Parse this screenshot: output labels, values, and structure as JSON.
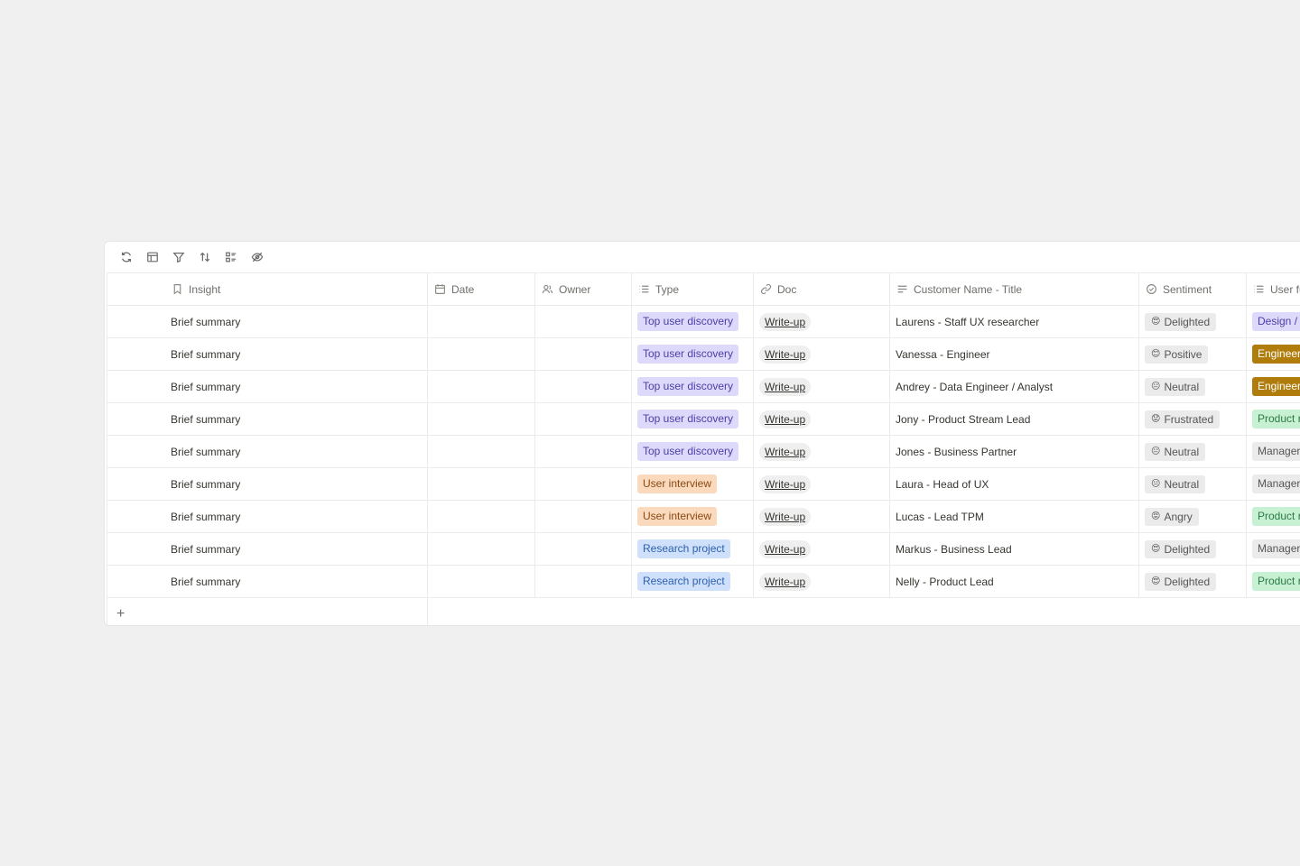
{
  "columns": {
    "insight": "Insight",
    "date": "Date",
    "owner": "Owner",
    "type": "Type",
    "doc": "Doc",
    "customer": "Customer Name - Title",
    "sentiment": "Sentiment",
    "user": "User fu"
  },
  "toolbar_icons": [
    "refresh-icon",
    "layout-icon",
    "filter-icon",
    "sort-icon",
    "group-icon",
    "hide-fields-icon"
  ],
  "type_colors": {
    "Top user discovery": {
      "bg": "#ddd9fb",
      "fg": "#4b3fa8"
    },
    "User interview": {
      "bg": "#fbd9bd",
      "fg": "#8a4a14"
    },
    "Research project": {
      "bg": "#cfe0fb",
      "fg": "#2d5fb0"
    }
  },
  "user_colors": {
    "Design /": {
      "bg": "#ddd9fb",
      "fg": "#4b3fa8"
    },
    "Engineer": {
      "bg": "#b07d0c",
      "fg": "#ffffff"
    },
    "Product r": {
      "bg": "#c8f0d3",
      "fg": "#2b7a45"
    },
    "Manager": {
      "bg": "#ebebeb",
      "fg": "#555555"
    }
  },
  "rows": [
    {
      "insight": "Brief summary",
      "type": "Top user discovery",
      "doc": "Write-up",
      "customer": "Laurens - Staff UX researcher",
      "emoji": "😍",
      "sentiment": "Delighted",
      "user": "Design /"
    },
    {
      "insight": "Brief summary",
      "type": "Top user discovery",
      "doc": "Write-up",
      "customer": "Vanessa - Engineer",
      "emoji": "😊",
      "sentiment": "Positive",
      "user": "Engineer"
    },
    {
      "insight": "Brief summary",
      "type": "Top user discovery",
      "doc": "Write-up",
      "customer": "Andrey - Data Engineer / Analyst",
      "emoji": "😐",
      "sentiment": "Neutral",
      "user": "Engineer"
    },
    {
      "insight": "Brief summary",
      "type": "Top user discovery",
      "doc": "Write-up",
      "customer": "Jony - Product Stream Lead",
      "emoji": "😟",
      "sentiment": "Frustrated",
      "user": "Product r"
    },
    {
      "insight": "Brief summary",
      "type": "Top user discovery",
      "doc": "Write-up",
      "customer": "Jones - Business Partner",
      "emoji": "😐",
      "sentiment": "Neutral",
      "user": "Manager"
    },
    {
      "insight": "Brief summary",
      "type": "User interview",
      "doc": "Write-up",
      "customer": "Laura - Head of UX",
      "emoji": "😐",
      "sentiment": "Neutral",
      "user": "Manager"
    },
    {
      "insight": "Brief summary",
      "type": "User interview",
      "doc": "Write-up",
      "customer": "Lucas - Lead TPM",
      "emoji": "😡",
      "sentiment": "Angry",
      "user": "Product r"
    },
    {
      "insight": "Brief summary",
      "type": "Research project",
      "doc": "Write-up",
      "customer": "Markus - Business Lead",
      "emoji": "😍",
      "sentiment": "Delighted",
      "user": "Manager"
    },
    {
      "insight": "Brief summary",
      "type": "Research project",
      "doc": "Write-up",
      "customer": "Nelly - Product Lead",
      "emoji": "😍",
      "sentiment": "Delighted",
      "user": "Product r"
    }
  ],
  "add_row_label": "+"
}
